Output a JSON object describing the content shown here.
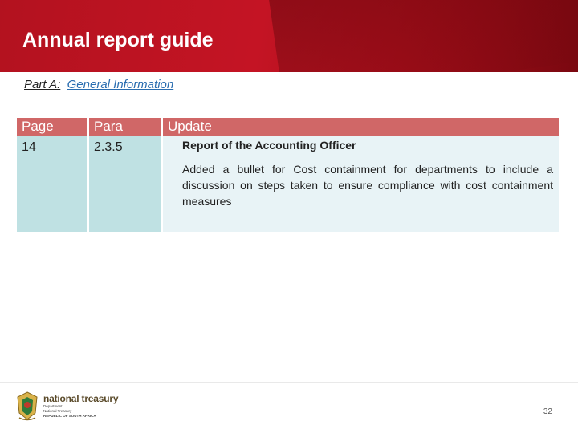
{
  "header": {
    "title": "Annual report guide"
  },
  "subtitle": {
    "prefix": "Part A:",
    "link": "General Information"
  },
  "table": {
    "headers": [
      "Page",
      "Para",
      "Update"
    ],
    "row": {
      "page": "14",
      "para": "2.3.5",
      "update_title": "Report of the Accounting Officer",
      "update_text": "Added a bullet for Cost containment for departments to include a discussion on steps taken to ensure compliance with cost containment measures"
    }
  },
  "footer": {
    "org_name": "national treasury",
    "lines": [
      "Department:",
      "National Treasury",
      "REPUBLIC OF SOUTH AFRICA"
    ],
    "page_number": "32",
    "logo_icon": "coat-of-arms-icon"
  },
  "colors": {
    "header": "#c41424",
    "column_head": "#d06767",
    "teal": "#bfe1e3",
    "light": "#e8f3f6"
  }
}
